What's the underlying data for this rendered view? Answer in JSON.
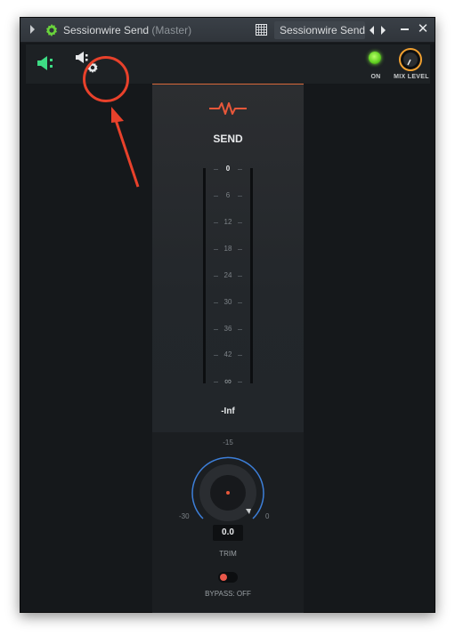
{
  "titlebar": {
    "plugin_name": "Sessionwire Send",
    "channel": "(Master)",
    "preset_name": "Sessionwire Send",
    "icons": [
      "collapse-arrow-icon",
      "gear-icon",
      "grid-icon",
      "prev-arrow-icon",
      "next-arrow-icon",
      "minimize-icon",
      "close-icon"
    ]
  },
  "toolbar": {
    "on_label": "ON",
    "mix_level_label": "MIX LEVEL",
    "icons": [
      "send-speaker-icon",
      "settings-speaker-gear-icon"
    ]
  },
  "panel": {
    "title": "SEND",
    "meter_ticks": [
      "0",
      "6",
      "12",
      "18",
      "24",
      "30",
      "36",
      "42",
      "∞"
    ],
    "meter_value": "-Inf",
    "trim": {
      "scale_top": "-15",
      "scale_min": "-30",
      "scale_max": "0",
      "value": "0.0",
      "label": "TRIM"
    },
    "bypass_label": "BYPASS: OFF"
  },
  "colors": {
    "accent_orange": "#d9683a",
    "led_green": "#5fcf20",
    "icon_green": "#3ddc84",
    "knob_ring_blue": "#3d7fd9",
    "mix_knob_ring": "#f0a030",
    "annotation_red": "#e8412b"
  }
}
